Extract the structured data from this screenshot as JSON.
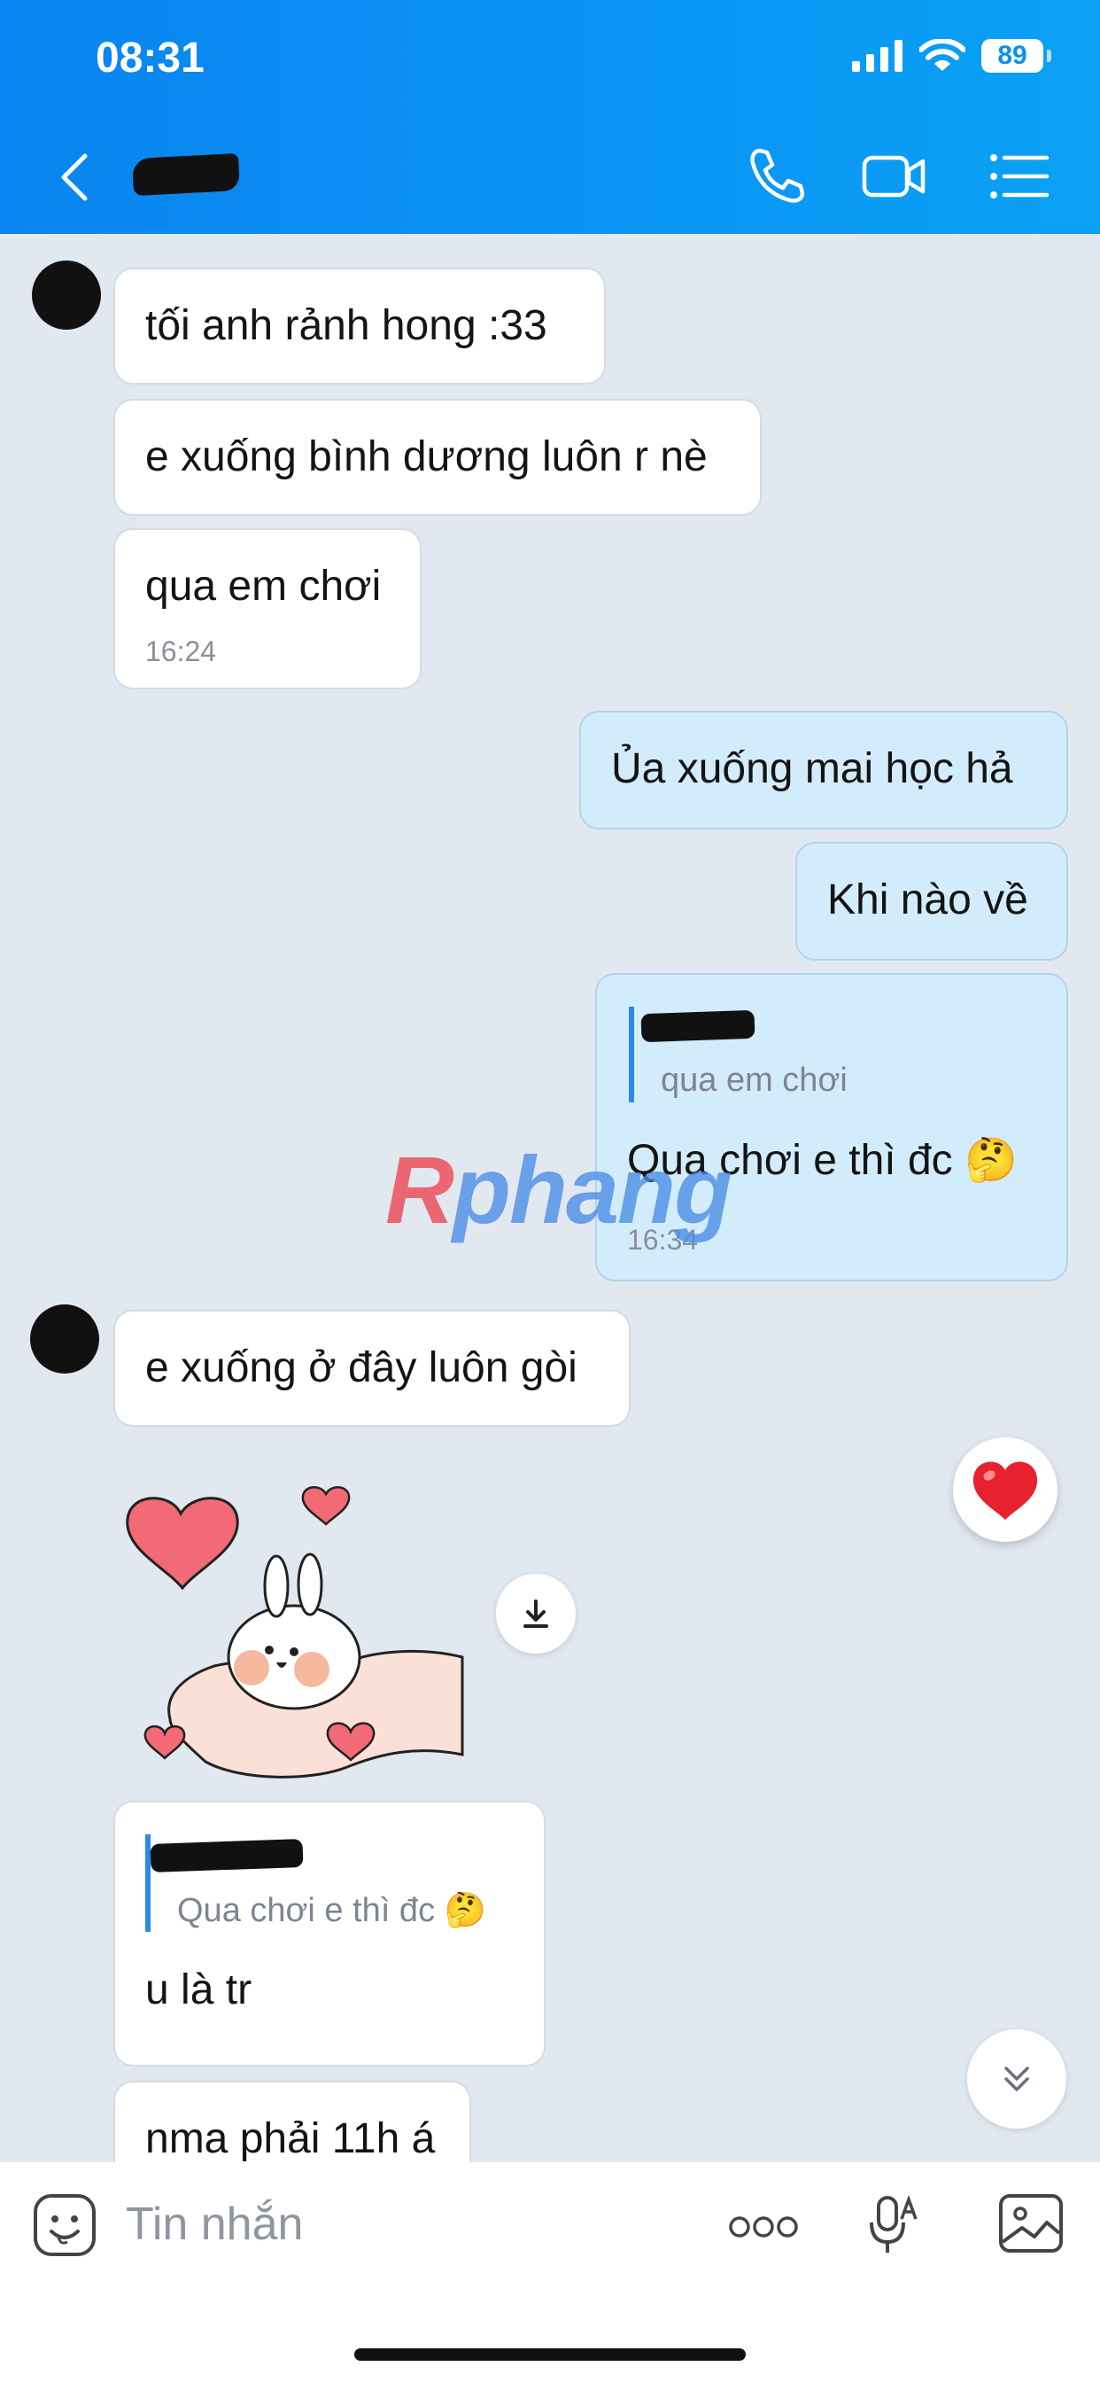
{
  "status_bar": {
    "time": "08:31",
    "battery": "89"
  },
  "header": {
    "back_icon": "chevron-left-icon",
    "actions": [
      "phone-icon",
      "video-camera-icon",
      "menu-list-icon"
    ],
    "accent_color": "#0a8ff0"
  },
  "messages": [
    {
      "from": "them",
      "text": "tối anh rảnh hong :33"
    },
    {
      "from": "them",
      "text": "e xuống bình dương luôn r nè"
    },
    {
      "from": "them",
      "text": "qua em chơi",
      "time": "16:24"
    },
    {
      "from": "me",
      "text": "Ủa xuống mai học hả"
    },
    {
      "from": "me",
      "text": "Khi nào về"
    },
    {
      "from": "me",
      "quote": "qua em chơi",
      "text": "Qua chơi e thì đc 🤔",
      "time": "16:34"
    },
    {
      "from": "them",
      "text": "e xuống ở đây luôn gòi"
    },
    {
      "from": "them",
      "type": "sticker",
      "sticker": "bunny-hearts-sticker"
    },
    {
      "from": "them",
      "quote": "Qua chơi e thì đc 🤔",
      "text": "u là tr"
    },
    {
      "from": "them",
      "text": "nma phải 11h á"
    }
  ],
  "watermark": {
    "first": "R",
    "rest": "phang"
  },
  "reaction": "heart",
  "composer": {
    "placeholder": "Tin nhắn"
  }
}
